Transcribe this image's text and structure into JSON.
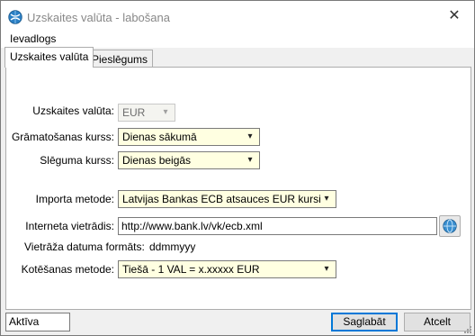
{
  "window": {
    "title": "Uzskaites valūta - labošana",
    "close_symbol": "✕"
  },
  "menu": {
    "items": [
      {
        "label": "Ievadlogs"
      }
    ]
  },
  "tabs": [
    {
      "label": "Uzskaites valūta",
      "active": true
    },
    {
      "label": "Pieslēgums",
      "active": false
    }
  ],
  "form": {
    "currency": {
      "label": "Uzskaites valūta:",
      "value": "EUR"
    },
    "booking_rate": {
      "label": "Grāmatošanas kurss:",
      "value": "Dienas sākumā"
    },
    "closing_rate": {
      "label": "Slēguma kurss:",
      "value": "Dienas beigās"
    },
    "import_method": {
      "label": "Importa metode:",
      "value": "Latvijas Bankas ECB atsauces EUR kursi"
    },
    "website": {
      "label": "Interneta vietrādis:",
      "value": "http://www.bank.lv/vk/ecb.xml"
    },
    "date_format": {
      "label": "Vietrāža datuma formāts:",
      "value": "ddmmyyy"
    },
    "quote_method": {
      "label": "Kotēšanas metode:",
      "value": "Tiešā - 1 VAL = x.xxxxx EUR"
    }
  },
  "status": {
    "value": "Aktīva"
  },
  "buttons": {
    "save": "Saglabāt",
    "cancel": "Atcelt"
  },
  "icons": {
    "app": "app-globe-icon",
    "open_url": "globe-icon",
    "dropdown": "chevron-down-icon"
  },
  "colors": {
    "input_bg": "#ffffe1",
    "accent": "#0078d7"
  }
}
